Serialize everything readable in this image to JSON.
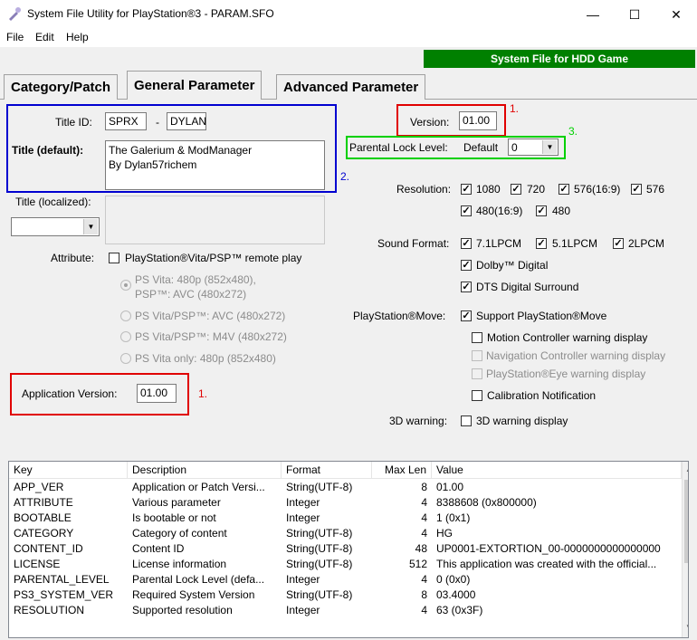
{
  "window": {
    "title": "System File Utility for PlayStation®3 - PARAM.SFO",
    "minimize": "—",
    "maximize": "☐",
    "close": "✕"
  },
  "menu": {
    "file": "File",
    "edit": "Edit",
    "help": "Help"
  },
  "badge": "System File for HDD Game",
  "tabs": {
    "category_patch": "Category/Patch",
    "general_parameter": "General Parameter",
    "advanced_parameter": "Advanced Parameter"
  },
  "general": {
    "title_id_label": "Title ID:",
    "title_id_part1": "SPRX",
    "title_id_sep": "-",
    "title_id_part2": "DYLAN",
    "title_default_label": "Title (default):",
    "title_default_value": "The Galerium & ModManager\nBy Dylan57richem",
    "title_localized_label": "Title (localized):",
    "attribute_label": "Attribute:",
    "attribute_remote_play": "PlayStation®Vita/PSP™ remote play",
    "radio1_line1": "PS Vita: 480p (852x480),",
    "radio1_line2": "PSP™: AVC (480x272)",
    "radio2": "PS Vita/PSP™: AVC (480x272)",
    "radio3": "PS Vita/PSP™: M4V (480x272)",
    "radio4": "PS Vita only: 480p (852x480)",
    "app_version_label": "Application Version:",
    "app_version_value": "01.00",
    "version_label": "Version:",
    "version_value": "01.00",
    "parental_label": "Parental Lock Level:",
    "parental_default": "Default",
    "parental_value": "0",
    "resolution_label": "Resolution:",
    "res_1080": "1080",
    "res_720": "720",
    "res_576_169": "576(16:9)",
    "res_576": "576",
    "res_480_169": "480(16:9)",
    "res_480": "480",
    "sound_label": "Sound Format:",
    "snd_71": "7.1LPCM",
    "snd_51": "5.1LPCM",
    "snd_2": "2LPCM",
    "snd_dolby": "Dolby™ Digital",
    "snd_dts": "DTS Digital Surround",
    "move_label": "PlayStation®Move:",
    "move_support": "Support PlayStation®Move",
    "move_motion": "Motion Controller warning display",
    "move_navigation": "Navigation Controller warning display",
    "move_eye": "PlayStation®Eye warning display",
    "move_calibration": "Calibration Notification",
    "warn3d_label": "3D warning:",
    "warn3d_check": "3D warning display"
  },
  "annotations": {
    "n1a": "1.",
    "n1b": "1.",
    "n2": "2.",
    "n3": "3.",
    "red": "#e00000",
    "blue": "#0000d0",
    "green": "#00d000"
  },
  "table": {
    "headers": [
      "Key",
      "Description",
      "Format",
      "Max Len",
      "Value"
    ],
    "rows": [
      [
        "APP_VER",
        "Application or Patch Versi...",
        "String(UTF-8)",
        "8",
        "01.00"
      ],
      [
        "ATTRIBUTE",
        "Various parameter",
        "Integer",
        "4",
        "8388608 (0x800000)"
      ],
      [
        "BOOTABLE",
        "Is bootable or not",
        "Integer",
        "4",
        "1 (0x1)"
      ],
      [
        "CATEGORY",
        "Category of content",
        "String(UTF-8)",
        "4",
        "HG"
      ],
      [
        "CONTENT_ID",
        "Content ID",
        "String(UTF-8)",
        "48",
        "UP0001-EXTORTION_00-0000000000000000"
      ],
      [
        "LICENSE",
        "License information",
        "String(UTF-8)",
        "512",
        "This application was created with the official..."
      ],
      [
        "PARENTAL_LEVEL",
        "Parental Lock Level (defa...",
        "Integer",
        "4",
        "0 (0x0)"
      ],
      [
        "PS3_SYSTEM_VER",
        "Required System Version",
        "String(UTF-8)",
        "8",
        "03.4000"
      ],
      [
        "RESOLUTION",
        "Supported resolution",
        "Integer",
        "4",
        "63 (0x3F)"
      ]
    ]
  }
}
